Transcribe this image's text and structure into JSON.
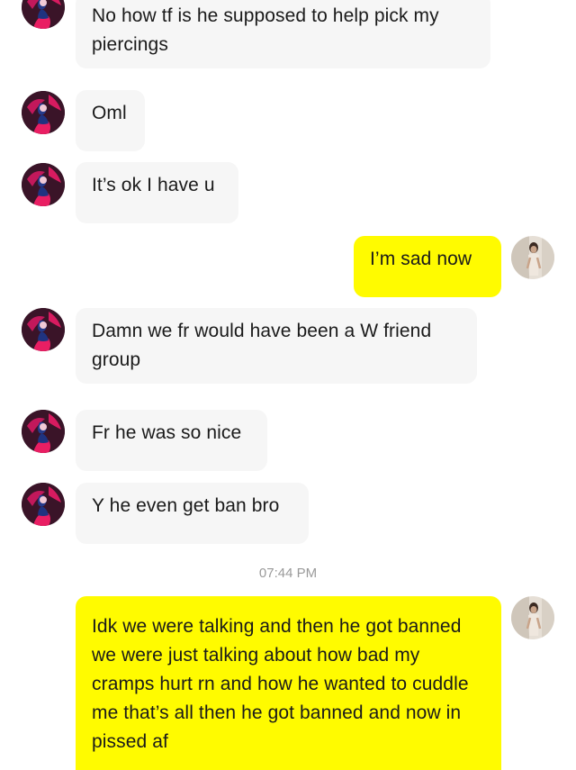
{
  "conversation": {
    "messages": [
      {
        "from": "them",
        "text": "No how tf is he supposed to help pick my piercings"
      },
      {
        "from": "them",
        "text": "Oml"
      },
      {
        "from": "them",
        "text": "It’s ok I have u"
      },
      {
        "from": "me",
        "text": "I’m sad now"
      },
      {
        "from": "them",
        "text": "Damn we fr would have been a W friend group"
      },
      {
        "from": "them",
        "text": "Fr he was so nice"
      },
      {
        "from": "them",
        "text": "Y he even get ban bro"
      },
      {
        "from": "me",
        "text": "Idk we were talking and then he got banned we were just talking about how bad my cramps hurt rn and how he wanted to cuddle me that’s all then he got banned and now in pissed af"
      }
    ],
    "timestamp": "07:44 PM"
  },
  "colors": {
    "my_bubble": "#fffb00",
    "their_bubble": "#f6f6f6",
    "text": "#1a1a1a",
    "timestamp": "#9a9a9a"
  },
  "icons": {
    "their_avatar": "contact-avatar-icon",
    "my_avatar": "user-avatar-icon"
  }
}
